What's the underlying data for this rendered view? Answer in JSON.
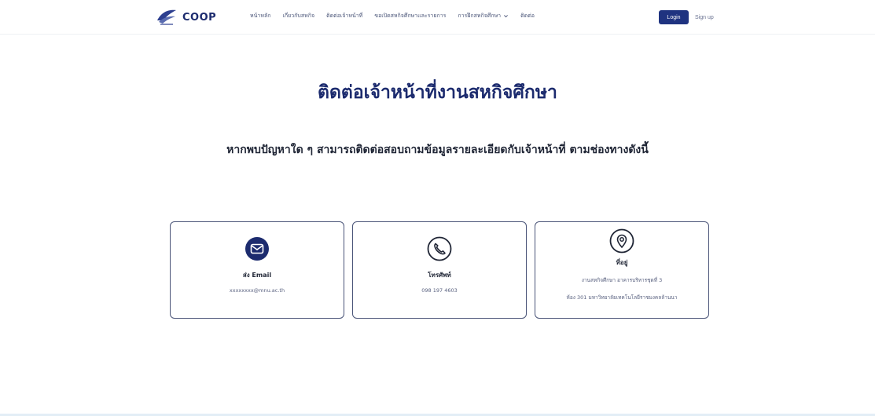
{
  "brand": {
    "name": "COOP"
  },
  "nav": {
    "links": [
      "หน้าหลัก",
      "เกี่ยวกับสหกิจ",
      "ติดต่อเจ้าหน้าที่",
      "ขอเปิดสหกิจศึกษาและรายการ",
      "การฝึกสหกิจศึกษา"
    ],
    "contact": "ติดต่อ",
    "login": "Login",
    "signup": "Sign up"
  },
  "page": {
    "title": "ติดต่อเจ้าหน้าที่งานสหกิจศึกษา",
    "subtitle": "หากพบปัญหาใด ๆ สามารถติดต่อสอบถามข้อมูลรายละเอียดกับเจ้าหน้าที่ ตามช่องทางดังนี้"
  },
  "cards": {
    "email": {
      "icon": "mail-icon",
      "title": "ส่ง Email",
      "text": "xxxxxxxx@mnu.ac.th"
    },
    "phone": {
      "icon": "phone-icon",
      "title": "โทรศัพท์",
      "text": "098 197 4603"
    },
    "address": {
      "icon": "location-icon",
      "title": "ที่อยู่",
      "line1": "งานสหกิจศึกษา อาคารบริหารชุดที่ 3",
      "line2": "ห้อง 301 มหาวิทยาลัยเทคโนโลยีราชมงคลล้านนา"
    }
  },
  "colors": {
    "navy": "#1c2b6e",
    "button": "#1f3380",
    "border": "#4a5478"
  }
}
